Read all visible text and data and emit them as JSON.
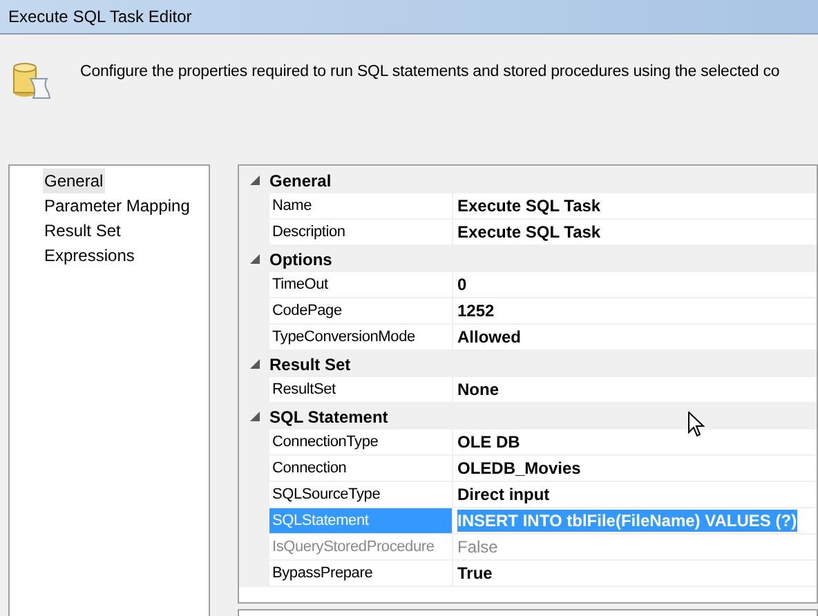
{
  "window": {
    "title": "Execute SQL Task Editor"
  },
  "header": {
    "description": "Configure the properties required to run SQL statements and stored procedures using the selected co"
  },
  "sidebar": {
    "items": [
      {
        "label": "General",
        "selected": true
      },
      {
        "label": "Parameter Mapping",
        "selected": false
      },
      {
        "label": "Result Set",
        "selected": false
      },
      {
        "label": "Expressions",
        "selected": false
      }
    ]
  },
  "property_grid": {
    "categories": [
      {
        "label": "General",
        "expanded": true,
        "properties": [
          {
            "name": "Name",
            "value": "Execute SQL Task",
            "selected": false,
            "disabled": false
          },
          {
            "name": "Description",
            "value": "Execute SQL Task",
            "selected": false,
            "disabled": false
          }
        ]
      },
      {
        "label": "Options",
        "expanded": true,
        "properties": [
          {
            "name": "TimeOut",
            "value": "0",
            "selected": false,
            "disabled": false
          },
          {
            "name": "CodePage",
            "value": "1252",
            "selected": false,
            "disabled": false
          },
          {
            "name": "TypeConversionMode",
            "value": "Allowed",
            "selected": false,
            "disabled": false
          }
        ]
      },
      {
        "label": "Result Set",
        "expanded": true,
        "properties": [
          {
            "name": "ResultSet",
            "value": "None",
            "selected": false,
            "disabled": false
          }
        ]
      },
      {
        "label": "SQL Statement",
        "expanded": true,
        "properties": [
          {
            "name": "ConnectionType",
            "value": "OLE DB",
            "selected": false,
            "disabled": false
          },
          {
            "name": "Connection",
            "value": "OLEDB_Movies",
            "selected": false,
            "disabled": false
          },
          {
            "name": "SQLSourceType",
            "value": "Direct input",
            "selected": false,
            "disabled": false
          },
          {
            "name": "SQLStatement",
            "value": "INSERT INTO tblFile(FileName) VALUES (?)",
            "selected": true,
            "disabled": false
          },
          {
            "name": "IsQueryStoredProcedure",
            "value": "False",
            "selected": false,
            "disabled": true
          },
          {
            "name": "BypassPrepare",
            "value": "True",
            "selected": false,
            "disabled": false
          }
        ]
      }
    ]
  }
}
